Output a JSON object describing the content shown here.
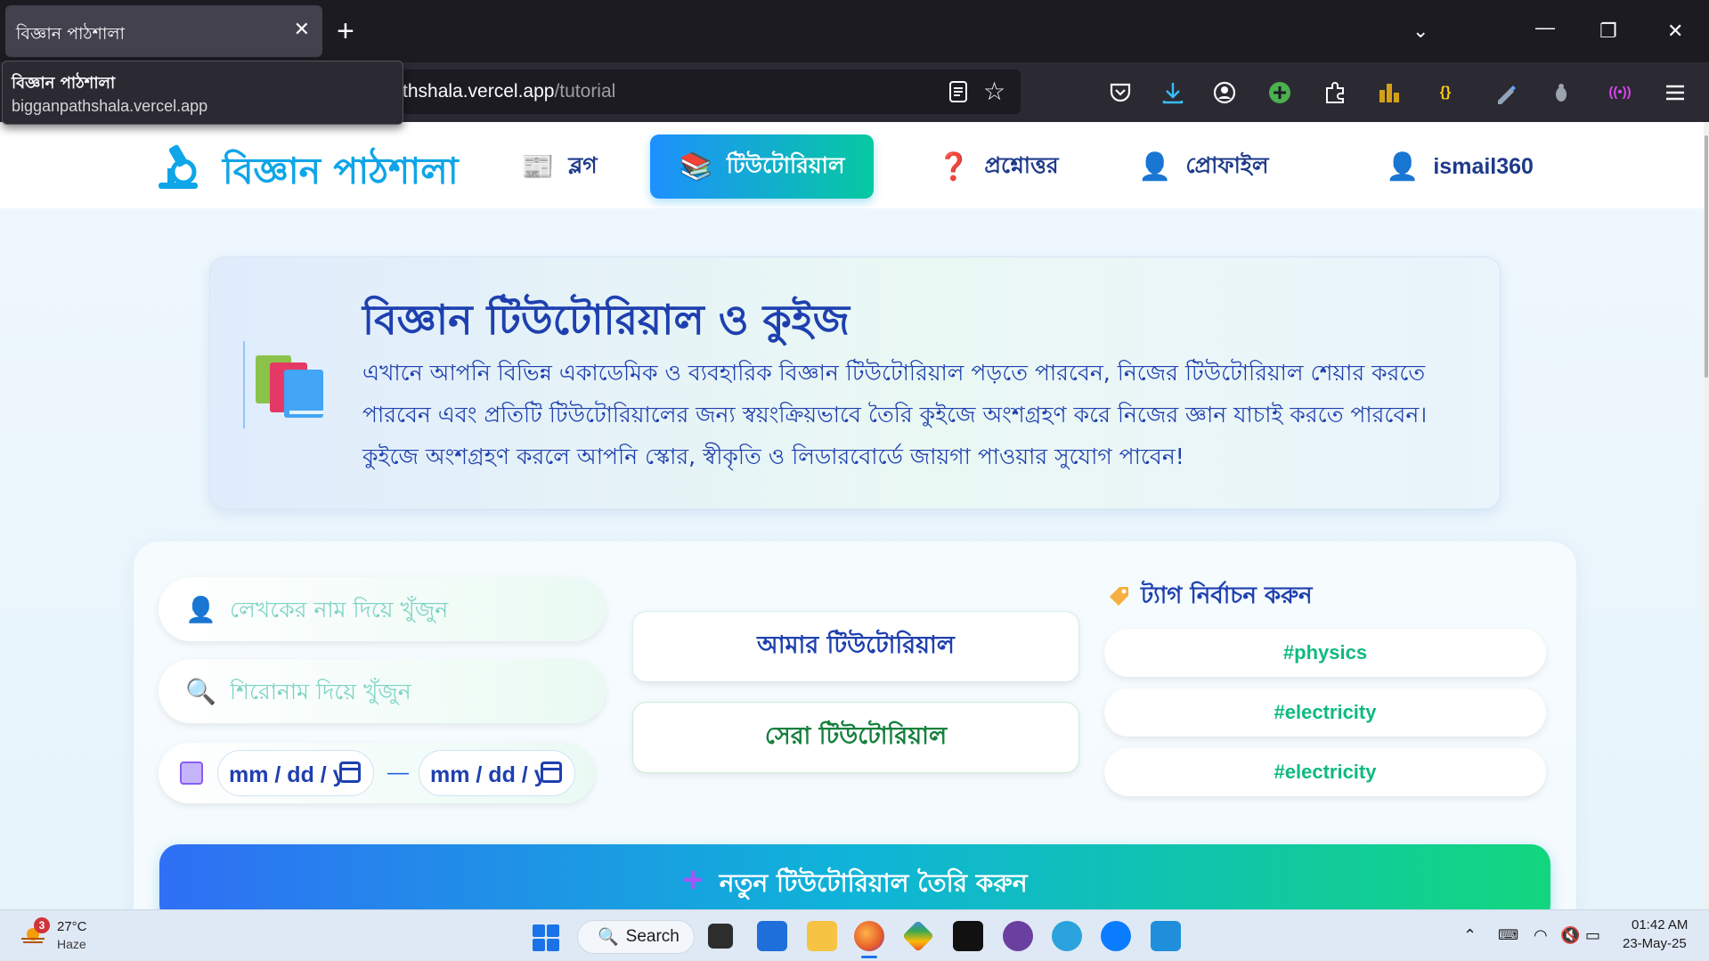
{
  "browser": {
    "tab_title": "বিজ্ঞান পাঠশালা",
    "tab_close": "✕",
    "new_tab": "+",
    "url_host": "thshala.vercel.app",
    "url_path": "/tutorial",
    "tooltip": {
      "title": "বিজ্ঞান পাঠশালা",
      "url": "bigganpathshala.vercel.app"
    },
    "toolbar_icons": [
      "reader-view-icon",
      "bookmark-star-icon",
      "pocket-icon",
      "download-icon",
      "account-icon",
      "extension-plus-icon",
      "extensions-icon",
      "stats-extension-icon",
      "json-extension-icon",
      "color-picker-icon",
      "bug-extension-icon",
      "broadcast-extension-icon",
      "menu-icon"
    ]
  },
  "header": {
    "brand": "বিজ্ঞান পাঠশালা",
    "nav": [
      {
        "icon": "📰",
        "label": "ব্লগ"
      },
      {
        "icon": "📚",
        "label": "টিউটোরিয়াল"
      },
      {
        "icon": "❓",
        "label": "প্রশ্নোত্তর"
      },
      {
        "icon": "👤",
        "label": "প্রোফাইল"
      },
      {
        "icon": "👤",
        "label": "ismail360"
      }
    ]
  },
  "hero": {
    "title": "বিজ্ঞান টিউটোরিয়াল ও কুইজ",
    "description": "এখানে আপনি বিভিন্ন একাডেমিক ও ব্যবহারিক বিজ্ঞান টিউটোরিয়াল পড়তে পারবেন, নিজের টিউটোরিয়াল শেয়ার করতে পারবেন এবং প্রতিটি টিউটোরিয়ালের জন্য স্বয়ংক্রিয়ভাবে তৈরি কুইজে অংশগ্রহণ করে নিজের জ্ঞান যাচাই করতে পারবেন। কুইজে অংশগ্রহণ করলে আপনি স্কোর, স্বীকৃতি ও লিডারবোর্ডে জায়গা পাওয়ার সুযোগ পাবেন!"
  },
  "filters": {
    "author_placeholder": "লেখকের নাম দিয়ে খুঁজুন",
    "title_placeholder": "শিরোনাম দিয়ে খুঁজুন",
    "date_from": "mm / dd / yyyy",
    "date_to": "mm / dd / yyyy",
    "date_separator": "—",
    "my_tutorials": "আমার টিউটোরিয়াল",
    "best_tutorials": "সেরা টিউটোরিয়াল",
    "tag_heading": "ট্যাগ নির্বাচন করুন",
    "tags": [
      "#physics",
      "#electricity",
      "#electricity"
    ]
  },
  "create_button": {
    "plus": "+",
    "label": "নতুন টিউটোরিয়াল তৈরি করুন"
  },
  "taskbar": {
    "weather_temp": "27°C",
    "weather_cond": "Haze",
    "weather_badge": "3",
    "search": "Search",
    "time": "01:42 AM",
    "date": "23-May-25"
  },
  "colors": {
    "brand": "#0ea5e9",
    "primary_text": "#1e40af",
    "tag_green": "#10b981",
    "active_gradient_start": "#1e90ff",
    "active_gradient_end": "#06c9a0"
  }
}
